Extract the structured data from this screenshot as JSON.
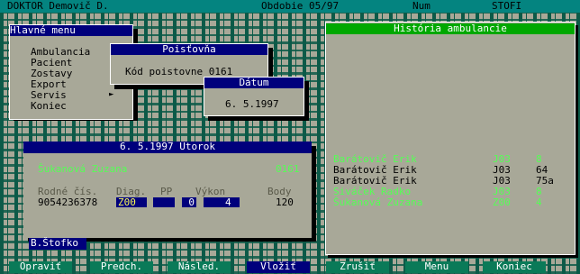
{
  "status_bar": {
    "user": "DOKTOR Demovič D.",
    "period": "Obdobie 05/97",
    "num": "Num",
    "app": "STOFI"
  },
  "main_menu": {
    "title": "Hlavné menu",
    "items": [
      "Ambulancia",
      "Pacient",
      "Zostavy",
      "Export",
      "Servis",
      "Koniec"
    ],
    "submenu_arrow": "►"
  },
  "insurance_window": {
    "title": "Poisťovňa",
    "label": "Kód poistovne 0161"
  },
  "date_window": {
    "title": "Dátum",
    "value": "6. 5.1997"
  },
  "patient_window": {
    "title": "6. 5.1997 Utorok",
    "patient_name": "Šukanová Zuzana",
    "insurance_code": "0161",
    "headers": {
      "birth_no": "Rodné čís.",
      "diag": "Diag.",
      "pp": "PP",
      "vykon": "Výkon",
      "body": "Body"
    },
    "values": {
      "birth_no": "9054236378",
      "diag": "Z00",
      "pp": "",
      "pp2": "0",
      "vykon": "4",
      "body": "120"
    },
    "doctor": "B.Štofko"
  },
  "history_window": {
    "title": "História ambulancie",
    "rows": [
      {
        "name": "Barátovič Erik",
        "diag": "J03",
        "vykon": "8",
        "color": "#54ff54"
      },
      {
        "name": "Barátovič Erik",
        "diag": "J03",
        "vykon": "64",
        "color": "#000000"
      },
      {
        "name": "Barátovič Erik",
        "diag": "J03",
        "vykon": "75a",
        "color": "#000000"
      },
      {
        "name": "Siváček Radko",
        "diag": "J03",
        "vykon": "8",
        "color": "#54ff54"
      },
      {
        "name": "Šukanová Zuzana",
        "diag": "Z00",
        "vykon": "4",
        "color": "#54ff54"
      }
    ]
  },
  "function_keys": [
    "Opraviť",
    "Predch.",
    "Násled.",
    "Vložiť",
    "Zrušiť",
    "Menu",
    "Koniec"
  ],
  "active_function_key": "Vložiť",
  "colors": {
    "status_bar": "#048480",
    "window_bg": "#a8a898",
    "title_navy": "#00007c",
    "title_green": "#00a800",
    "highlight_green": "#54ff54",
    "field_yellow": "#ffff54"
  }
}
